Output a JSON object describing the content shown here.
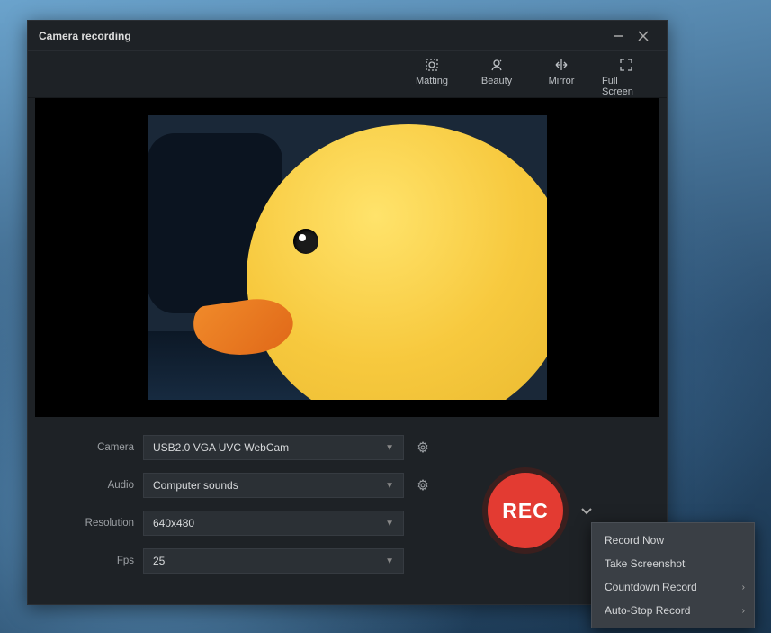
{
  "window": {
    "title": "Camera recording"
  },
  "toolbar": {
    "matting": "Matting",
    "beauty": "Beauty",
    "mirror": "Mirror",
    "fullscreen": "Full Screen"
  },
  "settings": {
    "camera_label": "Camera",
    "camera_value": "USB2.0 VGA UVC WebCam",
    "audio_label": "Audio",
    "audio_value": "Computer sounds",
    "resolution_label": "Resolution",
    "resolution_value": "640x480",
    "fps_label": "Fps",
    "fps_value": "25"
  },
  "rec": {
    "label": "REC"
  },
  "menu": {
    "record_now": "Record Now",
    "take_screenshot": "Take Screenshot",
    "countdown": "Countdown Record",
    "autostop": "Auto-Stop Record"
  }
}
